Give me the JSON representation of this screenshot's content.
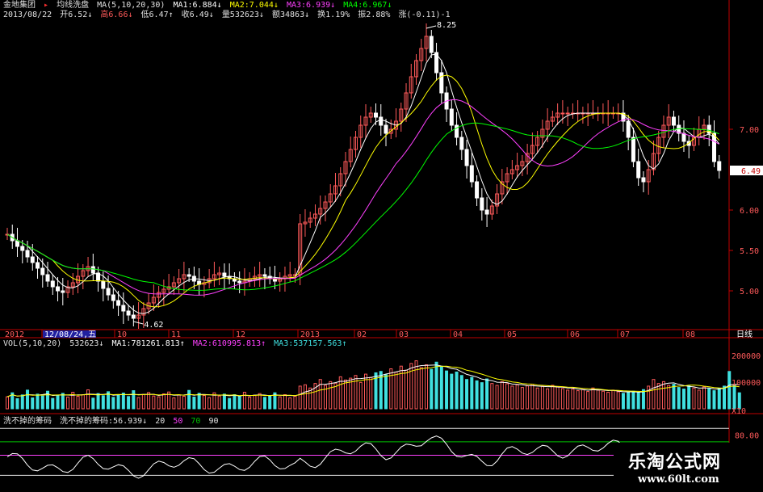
{
  "header": {
    "stock_name": "金地集团",
    "indicator": "均线洗盘",
    "ma_params": "MA(5,10,20,30)",
    "ma1": "MA1:6.884↓",
    "ma2": "MA2:7.044↓",
    "ma3": "MA3:6.939↓",
    "ma4": "MA4:6.967↓",
    "date": "2013/08/22",
    "open": "开6.52↓",
    "high": "高6.66↓",
    "low": "低6.47↑",
    "close": "收6.49↓",
    "volume": "量532623↓",
    "amount": "额34863↓",
    "turnover": "换1.19%",
    "amplitude": "振2.88%",
    "change": "涨(-0.11)-1"
  },
  "vol_header": {
    "name": "VOL(5,10,20)",
    "value": "532623↓",
    "ma1": "MA1:781261.813↑",
    "ma2": "MA2:610995.813↑",
    "ma3": "MA3:537157.563↑"
  },
  "osc_header": {
    "name": "洗不掉的筹码",
    "label": "洗不掉的筹码:56.939↓",
    "l20": "20",
    "l50": "50",
    "l70": "70",
    "l90": "90"
  },
  "watermark": {
    "title": "乐淘公式网",
    "url": "www.60lt.com"
  },
  "colors": {
    "up": "#ff5a5a",
    "down": "#ffffff",
    "ma1": "#ffffff",
    "ma2": "#ffff00",
    "ma3": "#ff40ff",
    "ma4": "#00ff00",
    "axis": "#c00000",
    "header_cyan": "#40e0e0"
  },
  "chart_data": {
    "type": "candlestick",
    "price_axis": {
      "ticks": [
        "7.00",
        "6.00",
        "5.50",
        "5.00"
      ],
      "current": "6.49",
      "ylim": [
        4.55,
        8.35
      ]
    },
    "annotations": {
      "high": "8.25",
      "low": "4.62"
    },
    "x_axis": {
      "labels": [
        "2012",
        "12/08/24,五",
        "10",
        "11",
        "12",
        "2013",
        "02",
        "03",
        "04",
        "05",
        "06",
        "07",
        "08",
        "日线"
      ]
    },
    "close_series": [
      5.7,
      5.62,
      5.55,
      5.5,
      5.42,
      5.35,
      5.28,
      5.2,
      5.12,
      5.05,
      5.0,
      4.98,
      5.05,
      5.1,
      5.18,
      5.25,
      5.3,
      5.22,
      5.12,
      5.03,
      4.95,
      4.88,
      4.82,
      4.75,
      4.7,
      4.66,
      4.7,
      4.78,
      4.85,
      4.92,
      4.98,
      5.02,
      5.05,
      5.1,
      5.15,
      5.2,
      5.18,
      5.12,
      5.08,
      5.1,
      5.15,
      5.2,
      5.22,
      5.18,
      5.15,
      5.12,
      5.1,
      5.12,
      5.15,
      5.18,
      5.2,
      5.18,
      5.15,
      5.12,
      5.15,
      5.18,
      5.2,
      5.2,
      5.83,
      5.85,
      5.9,
      5.95,
      6.02,
      6.1,
      6.2,
      6.3,
      6.45,
      6.6,
      6.75,
      6.9,
      7.05,
      7.15,
      7.2,
      7.15,
      7.05,
      6.95,
      7.0,
      7.1,
      7.25,
      7.45,
      7.65,
      7.85,
      8.0,
      8.15,
      7.95,
      7.7,
      7.45,
      7.25,
      7.05,
      6.9,
      6.75,
      6.55,
      6.35,
      6.15,
      6.0,
      5.95,
      6.05,
      6.2,
      6.35,
      6.45,
      6.5,
      6.55,
      6.6,
      6.7,
      6.8,
      6.9,
      7.0,
      7.1,
      7.15,
      7.2,
      7.2,
      7.2,
      7.2,
      7.2,
      7.2,
      7.2,
      7.2,
      7.2,
      7.2,
      7.2,
      7.2,
      7.2,
      7.1,
      6.9,
      6.6,
      6.4,
      6.35,
      6.5,
      6.7,
      6.9,
      7.05,
      7.15,
      7.05,
      6.95,
      6.85,
      6.8,
      6.9,
      7.0,
      7.05,
      6.95,
      6.6,
      6.49
    ],
    "volume_axis": {
      "ticks": [
        "200000",
        "100000",
        "X10"
      ]
    },
    "volume_series": [
      45,
      60,
      38,
      52,
      70,
      41,
      55,
      48,
      66,
      39,
      50,
      58,
      44,
      62,
      47,
      53,
      71,
      40,
      57,
      49,
      64,
      43,
      51,
      59,
      46,
      68,
      42,
      54,
      61,
      48,
      45,
      56,
      63,
      41,
      52,
      47,
      69,
      44,
      58,
      50,
      42,
      60,
      48,
      55,
      39,
      53,
      46,
      62,
      44,
      51,
      57,
      43,
      49,
      60,
      45,
      53,
      41,
      47,
      85,
      90,
      78,
      95,
      110,
      88,
      102,
      96,
      120,
      108,
      115,
      125,
      99,
      130,
      118,
      135,
      140,
      128,
      150,
      138,
      160,
      145,
      170,
      180,
      155,
      165,
      148,
      175,
      158,
      142,
      130,
      138,
      125,
      110,
      118,
      105,
      98,
      112,
      95,
      88,
      102,
      94,
      85,
      90,
      80,
      86,
      92,
      78,
      84,
      75,
      88,
      82,
      76,
      70,
      74,
      68,
      72,
      65,
      78,
      70,
      66,
      62,
      70,
      64,
      58,
      62,
      66,
      60,
      72,
      85,
      110,
      95,
      102,
      88,
      92,
      80,
      74,
      86,
      78,
      70,
      82,
      75,
      68,
      76,
      85,
      140,
      90,
      60
    ],
    "oscillator": {
      "ticks": [
        "80.00"
      ],
      "levels": [
        20,
        50,
        70,
        90
      ],
      "last": 56.939
    }
  }
}
